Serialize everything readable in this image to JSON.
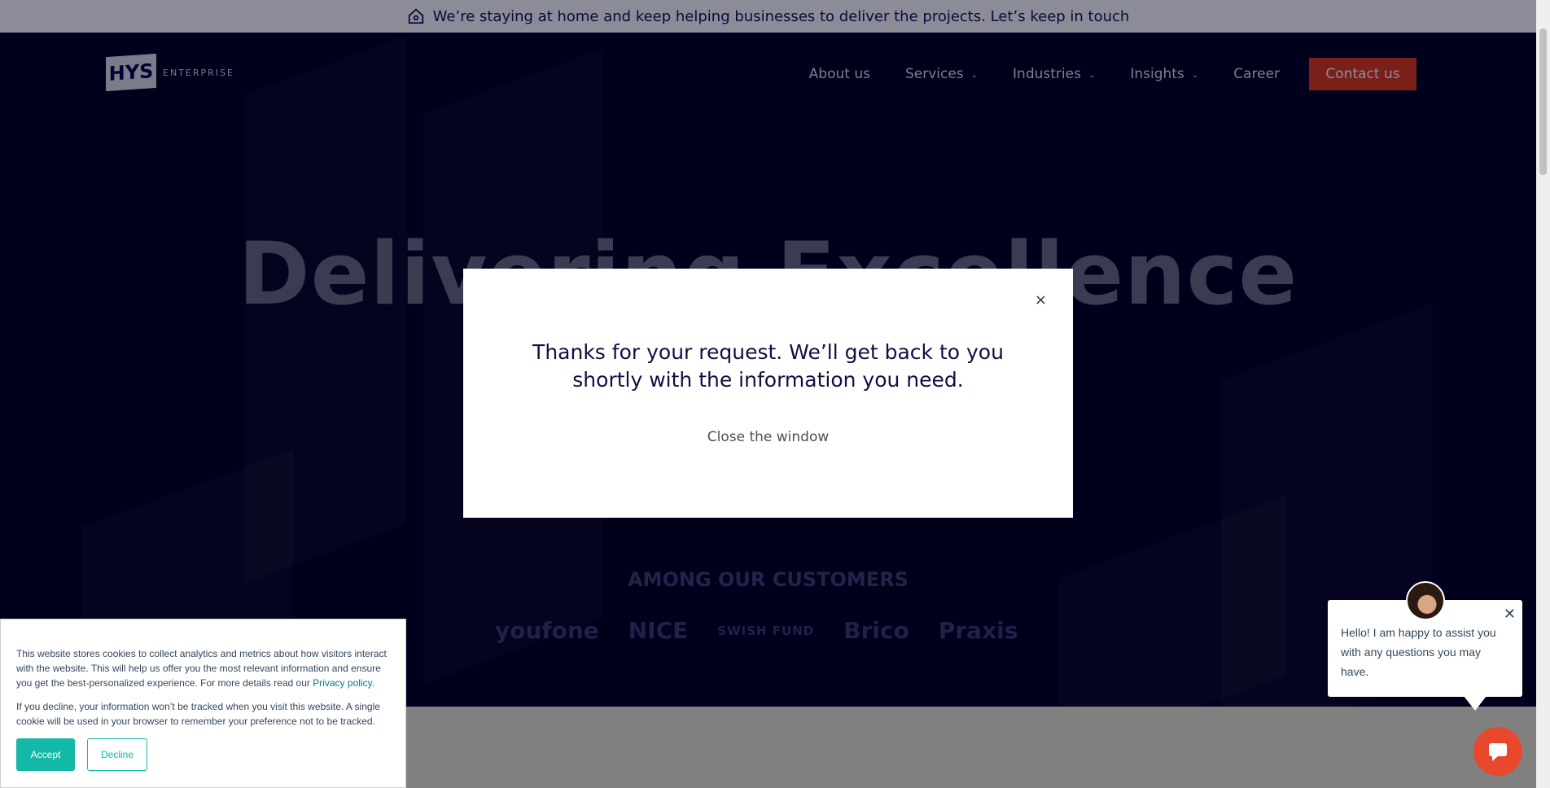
{
  "banner": {
    "icon": "house-icon",
    "text": "We’re staying at home and keep helping businesses to deliver the projects. Let’s keep in touch"
  },
  "header": {
    "logo_mark": "HYS",
    "logo_word": "ENTERPRISE",
    "nav": [
      {
        "label": "About us"
      },
      {
        "label": "Services"
      },
      {
        "label": "Industries"
      },
      {
        "label": "Insights"
      },
      {
        "label": "Career"
      }
    ],
    "cta": "Contact us"
  },
  "hero": {
    "headline": "Delivering Excellence",
    "customers_title": "AMONG OUR CUSTOMERS",
    "customer_logos": [
      "youfone",
      "NICE",
      "SWISH FUND",
      "Brico",
      "Praxis"
    ]
  },
  "modal": {
    "close_symbol": "×",
    "message_line1": "Thanks for your request. We’ll get back to you",
    "message_line2": "shortly with the information you need.",
    "close_link": "Close the window"
  },
  "cookie_banner": {
    "text1": "This website stores cookies to collect analytics and metrics about how visitors interact with the website. This will help us offer you the most relevant information and ensure you get the best-personalized experience. For more details read our",
    "privacy_link": "Privacy policy.",
    "text2": "If you decline, your information won’t be tracked when you visit this website. A single cookie will be used in your browser to remember your preference not to be tracked.",
    "accept": "Accept",
    "decline": "Decline"
  },
  "chat": {
    "message": "Hello! I am happy to assist you with any questions you may have.",
    "close_symbol": "✕"
  },
  "colors": {
    "hero_bg": "#000036",
    "cta": "#c0392b",
    "cookie_accent": "#14b8a6",
    "chat_launcher": "#e8492d"
  }
}
